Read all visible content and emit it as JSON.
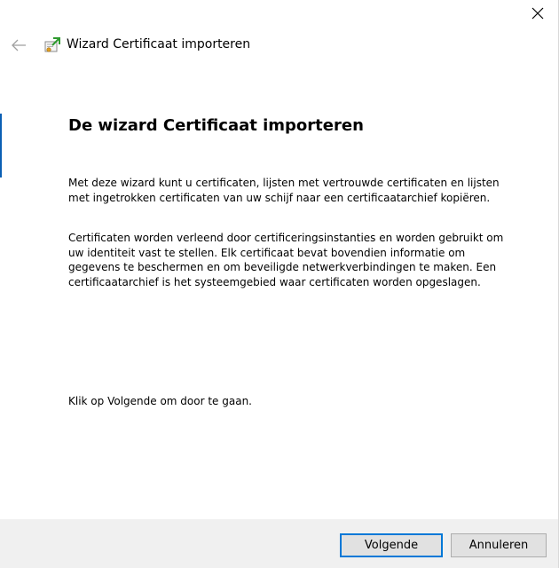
{
  "window": {
    "title": "Wizard Certificaat importeren"
  },
  "icons": {
    "back": "back-arrow-icon",
    "close": "close-icon",
    "certificate": "certificate-import-icon"
  },
  "content": {
    "heading": "De wizard Certificaat importeren",
    "paragraph1": "Met deze wizard kunt u certificaten, lijsten met vertrouwde certificaten en lijsten met ingetrokken certificaten van uw schijf naar een certificaatarchief kopiëren.",
    "paragraph2": "Certificaten worden verleend door certificeringsinstanties en worden gebruikt om uw identiteit vast te stellen. Elk certificaat bevat bovendien informatie om gegevens te beschermen en om beveiligde netwerkverbindingen te maken. Een certificaatarchief is het systeemgebied waar certificaten worden opgeslagen.",
    "paragraph3": "Klik op Volgende om door te gaan."
  },
  "buttons": {
    "next": "Volgende",
    "cancel": "Annuleren"
  },
  "colors": {
    "accent": "#0078d7",
    "footer_bg": "#f0f0f0",
    "button_bg": "#e1e1e1"
  }
}
